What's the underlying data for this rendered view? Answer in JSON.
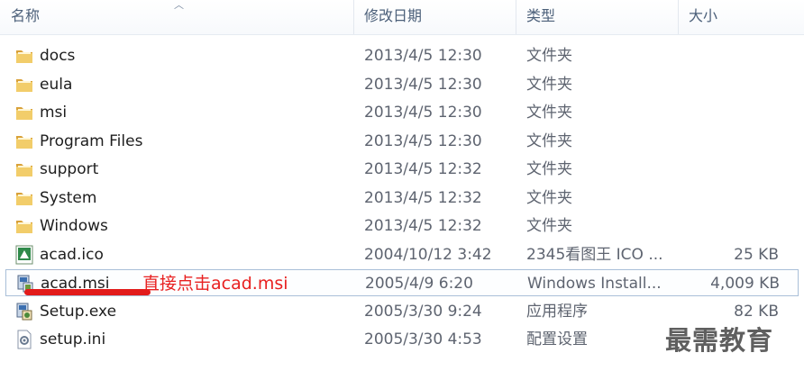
{
  "header": {
    "name": "名称",
    "date": "修改日期",
    "type": "类型",
    "size": "大小"
  },
  "files": [
    {
      "name": "docs",
      "date": "2013/4/5 12:30",
      "type": "文件夹",
      "size": "",
      "icon": "folder-icon"
    },
    {
      "name": "eula",
      "date": "2013/4/5 12:30",
      "type": "文件夹",
      "size": "",
      "icon": "folder-icon"
    },
    {
      "name": "msi",
      "date": "2013/4/5 12:30",
      "type": "文件夹",
      "size": "",
      "icon": "folder-icon"
    },
    {
      "name": "Program Files",
      "date": "2013/4/5 12:30",
      "type": "文件夹",
      "size": "",
      "icon": "folder-icon"
    },
    {
      "name": "support",
      "date": "2013/4/5 12:32",
      "type": "文件夹",
      "size": "",
      "icon": "folder-icon"
    },
    {
      "name": "System",
      "date": "2013/4/5 12:32",
      "type": "文件夹",
      "size": "",
      "icon": "folder-icon"
    },
    {
      "name": "Windows",
      "date": "2013/4/5 12:32",
      "type": "文件夹",
      "size": "",
      "icon": "folder-icon"
    },
    {
      "name": "acad.ico",
      "date": "2004/10/12 3:42",
      "type": "2345看图王 ICO ...",
      "size": "25 KB",
      "icon": "ico-file-icon"
    },
    {
      "name": "acad.msi",
      "date": "2005/4/9 6:20",
      "type": "Windows Install...",
      "size": "4,009 KB",
      "icon": "installer-icon"
    },
    {
      "name": "Setup.exe",
      "date": "2005/3/30 9:24",
      "type": "应用程序",
      "size": "82 KB",
      "icon": "setup-exe-icon"
    },
    {
      "name": "setup.ini",
      "date": "2005/3/30 4:53",
      "type": "配置设置",
      "size": "",
      "icon": "ini-file-icon"
    }
  ],
  "annotation": "直接点击acad.msi",
  "watermark": "最需教育",
  "colors": {
    "annotation": "#e82020",
    "folder": "#e8b84a",
    "header_text": "#4c607a",
    "selection_border": "#a9bfd8"
  }
}
